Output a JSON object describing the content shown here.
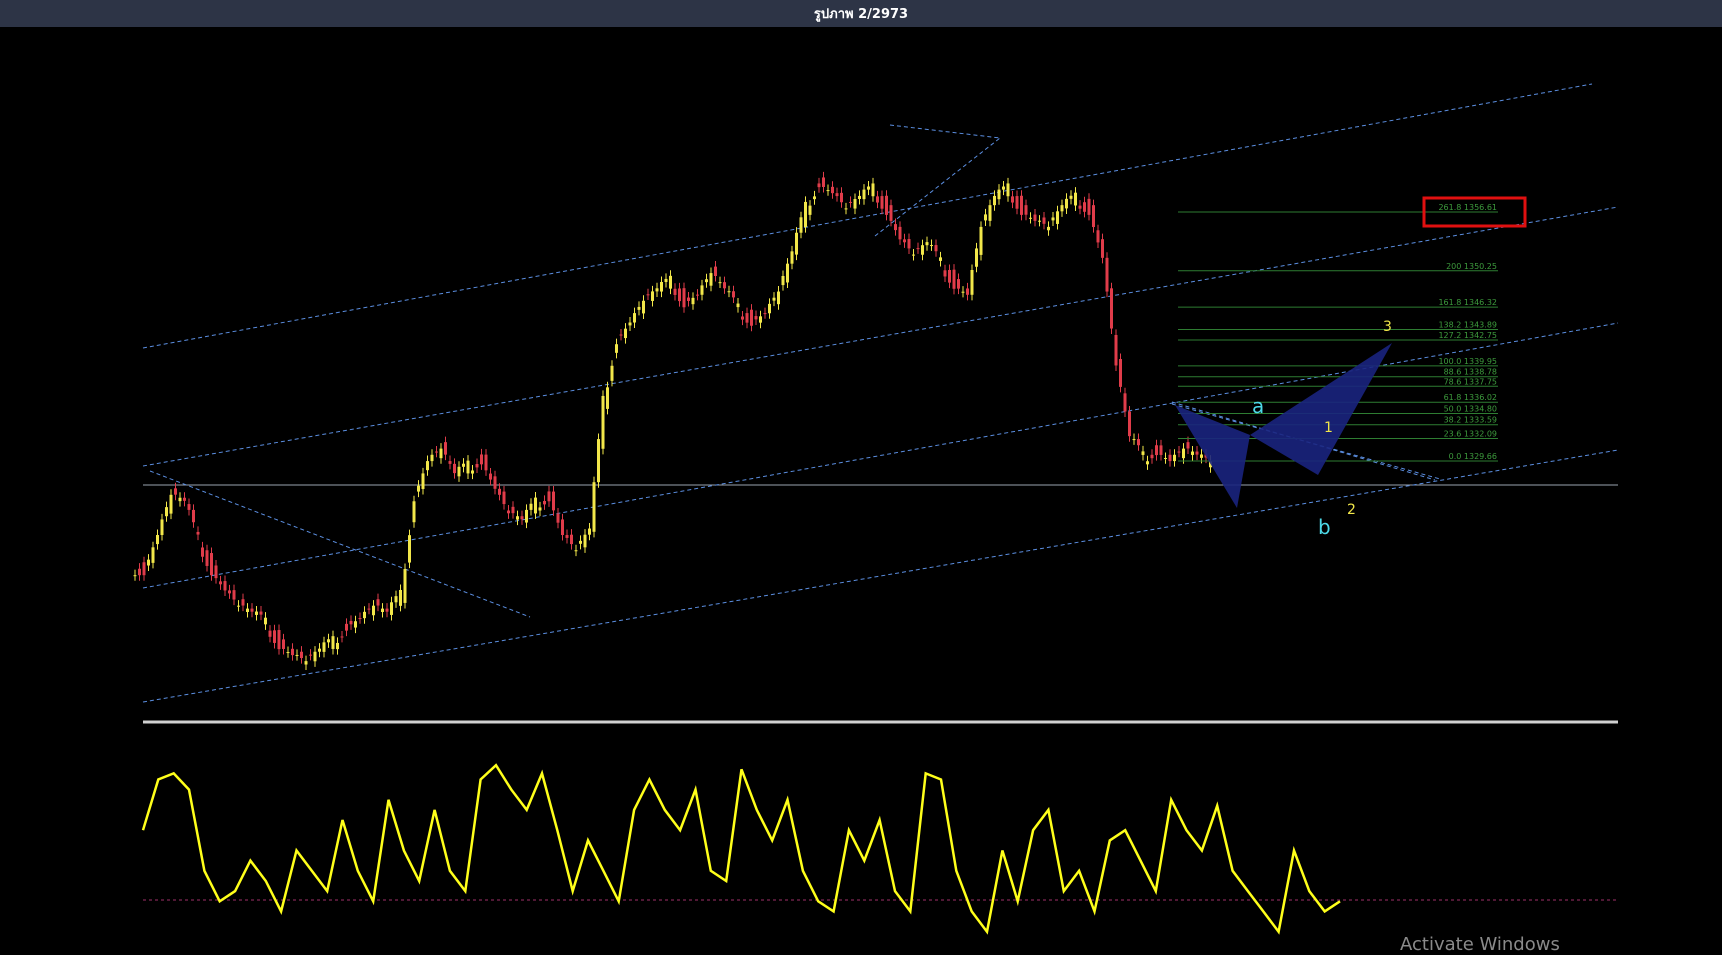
{
  "window": {
    "title": "รูปภาพ 2/2973"
  },
  "colors": {
    "background": "#000000",
    "bull_candle": "#f2e74a",
    "bear_candle": "#e03c4a",
    "channel": "#5b8ee0",
    "fib": "#2e7d32",
    "fib_text": "#3d9b3d",
    "pattern": "#1a237e",
    "oscillator": "#ffff1a",
    "highlight_box": "#e01010",
    "wave_cyan": "#4dd9e8",
    "wave_yellow": "#f2e74a"
  },
  "chart_data": {
    "type": "candlestick",
    "fib_levels": [
      {
        "pct": "261.8",
        "price": 1356.61,
        "label": "261.8 1356.61"
      },
      {
        "pct": "200",
        "price": 1350.25,
        "label": "200 1350.25"
      },
      {
        "pct": "161.8",
        "price": 1346.32,
        "label": "161.8 1346.32"
      },
      {
        "pct": "138.2",
        "price": 1343.89,
        "label": "138.2 1343.89"
      },
      {
        "pct": "127.2",
        "price": 1342.75,
        "label": "127.2 1342.75"
      },
      {
        "pct": "100.0",
        "price": 1339.95,
        "label": "100.0 1339.95"
      },
      {
        "pct": "88.6",
        "price": 1338.78,
        "label": "88.6 1338.78"
      },
      {
        "pct": "78.6",
        "price": 1337.75,
        "label": "78.6 1337.75"
      },
      {
        "pct": "61.8",
        "price": 1336.02,
        "label": "61.8 1336.02"
      },
      {
        "pct": "50.0",
        "price": 1334.8,
        "label": "50.0 1334.80"
      },
      {
        "pct": "38.2",
        "price": 1333.59,
        "label": "38.2 1333.59"
      },
      {
        "pct": "23.6",
        "price": 1332.09,
        "label": "23.6 1332.09"
      },
      {
        "pct": "0.0",
        "price": 1329.66,
        "label": "0.0 1329.66"
      }
    ],
    "wave_labels": [
      {
        "text": "a",
        "color": "cyan"
      },
      {
        "text": "b",
        "color": "cyan"
      },
      {
        "text": "1",
        "color": "yellow"
      },
      {
        "text": "2",
        "color": "yellow"
      },
      {
        "text": "3",
        "color": "yellow"
      }
    ],
    "highlight": {
      "level": "261.8 1356.61"
    },
    "close_path": [
      1318,
      1322,
      1326,
      1325,
      1321,
      1318,
      1316,
      1314,
      1313,
      1312,
      1310,
      1309,
      1308,
      1309,
      1310,
      1312,
      1313,
      1314,
      1313,
      1315,
      1326,
      1330,
      1331,
      1328,
      1329,
      1330,
      1327,
      1324,
      1323,
      1325,
      1326,
      1322,
      1320,
      1322,
      1336,
      1343,
      1345,
      1347,
      1348,
      1349,
      1347,
      1348,
      1350,
      1348,
      1346,
      1345,
      1346,
      1348,
      1352,
      1357,
      1360,
      1359,
      1357,
      1358,
      1359,
      1357,
      1354,
      1352,
      1353,
      1351,
      1349,
      1348,
      1355,
      1358,
      1359,
      1357,
      1356,
      1355,
      1357,
      1358,
      1357,
      1352,
      1340,
      1332,
      1330,
      1331,
      1330,
      1331,
      1330,
      1329
    ],
    "close_path_x_start": 135,
    "close_path_x_step": 13.5,
    "oscillator": [
      60,
      85,
      88,
      80,
      40,
      25,
      30,
      45,
      35,
      20,
      50,
      40,
      30,
      65,
      40,
      25,
      75,
      50,
      35,
      70,
      40,
      30,
      85,
      92,
      80,
      70,
      88,
      60,
      30,
      55,
      40,
      25,
      70,
      85,
      70,
      60,
      80,
      40,
      35,
      90,
      70,
      55,
      75,
      40,
      25,
      20,
      60,
      45,
      65,
      30,
      20,
      88,
      85,
      40,
      20,
      10,
      50,
      25,
      60,
      70,
      30,
      40,
      20,
      55,
      60,
      45,
      30,
      75,
      60,
      50,
      72,
      40,
      30,
      20,
      10,
      50,
      30,
      20,
      25
    ]
  }
}
